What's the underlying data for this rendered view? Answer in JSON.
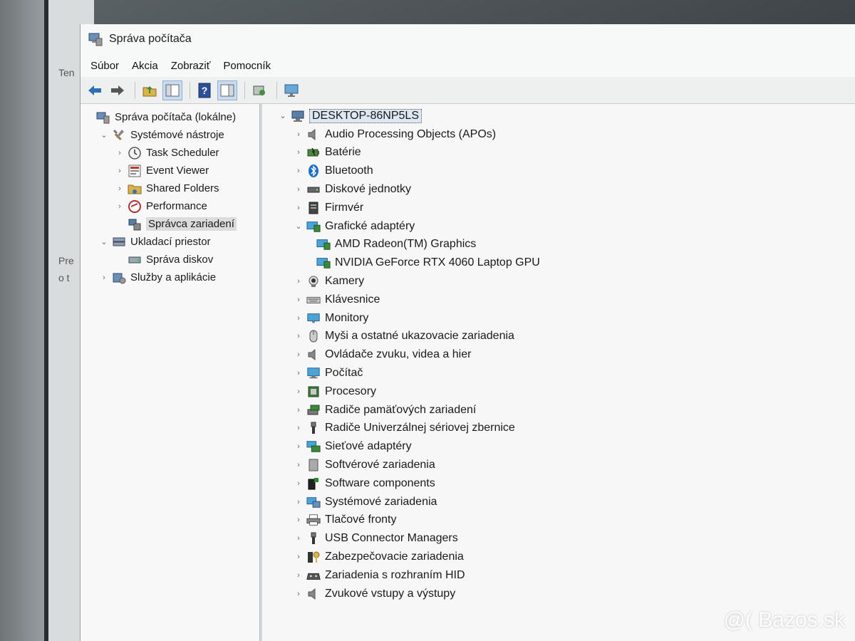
{
  "desktop": {
    "text_1": "Ten",
    "text_2": "Pre",
    "text_3": "o t"
  },
  "window": {
    "title": "Správa počítača"
  },
  "menu": [
    "Súbor",
    "Akcia",
    "Zobraziť",
    "Pomocník"
  ],
  "toolbar": [
    "back-icon",
    "forward-icon",
    "up-folder-icon",
    "console-tree-icon",
    "help-icon",
    "action-pane-icon",
    "properties-icon",
    "monitor-icon"
  ],
  "left_tree": [
    {
      "label": "Správa počítača (lokálne)",
      "indent": 0,
      "chev": "",
      "icon": "computer-management-icon"
    },
    {
      "label": "Systémové nástroje",
      "indent": 1,
      "chev": "v",
      "icon": "tools-icon"
    },
    {
      "label": "Task Scheduler",
      "indent": 2,
      "chev": ">",
      "icon": "clock-icon"
    },
    {
      "label": "Event Viewer",
      "indent": 2,
      "chev": ">",
      "icon": "event-viewer-icon"
    },
    {
      "label": "Shared Folders",
      "indent": 2,
      "chev": ">",
      "icon": "shared-folder-icon"
    },
    {
      "label": "Performance",
      "indent": 2,
      "chev": ">",
      "icon": "performance-icon"
    },
    {
      "label": "Správca zariadení",
      "indent": 2,
      "chev": "",
      "icon": "device-manager-icon",
      "selected": true
    },
    {
      "label": "Ukladací priestor",
      "indent": 1,
      "chev": "v",
      "icon": "storage-icon"
    },
    {
      "label": "Správa diskov",
      "indent": 2,
      "chev": "",
      "icon": "disk-management-icon"
    },
    {
      "label": "Služby a aplikácie",
      "indent": 1,
      "chev": ">",
      "icon": "services-icon"
    }
  ],
  "device_tree": {
    "root": "DESKTOP-86NP5LS",
    "items": [
      {
        "label": "Audio Processing Objects (APOs)",
        "icon": "speaker-icon",
        "expanded": false
      },
      {
        "label": "Batérie",
        "icon": "battery-icon",
        "expanded": false
      },
      {
        "label": "Bluetooth",
        "icon": "bluetooth-icon",
        "expanded": false
      },
      {
        "label": "Diskové jednotky",
        "icon": "disk-drive-icon",
        "expanded": false
      },
      {
        "label": "Firmvér",
        "icon": "firmware-icon",
        "expanded": false
      },
      {
        "label": "Grafické adaptéry",
        "icon": "display-adapter-icon",
        "expanded": true,
        "children": [
          {
            "label": "AMD Radeon(TM) Graphics",
            "icon": "display-adapter-icon"
          },
          {
            "label": "NVIDIA GeForce RTX 4060 Laptop GPU",
            "icon": "display-adapter-icon"
          }
        ]
      },
      {
        "label": "Kamery",
        "icon": "camera-icon",
        "expanded": false
      },
      {
        "label": "Klávesnice",
        "icon": "keyboard-icon",
        "expanded": false
      },
      {
        "label": "Monitory",
        "icon": "monitor-icon",
        "expanded": false
      },
      {
        "label": "Myši a ostatné ukazovacie zariadenia",
        "icon": "mouse-icon",
        "expanded": false
      },
      {
        "label": "Ovládače zvuku, videa a hier",
        "icon": "speaker-icon",
        "expanded": false
      },
      {
        "label": "Počítač",
        "icon": "computer-icon",
        "expanded": false
      },
      {
        "label": "Procesory",
        "icon": "processor-icon",
        "expanded": false
      },
      {
        "label": "Radiče pamäťových zariadení",
        "icon": "storage-controller-icon",
        "expanded": false
      },
      {
        "label": "Radiče Univerzálnej sériovej zbernice",
        "icon": "usb-icon",
        "expanded": false
      },
      {
        "label": "Sieťové adaptéry",
        "icon": "network-adapter-icon",
        "expanded": false
      },
      {
        "label": "Softvérové zariadenia",
        "icon": "software-device-icon",
        "expanded": false
      },
      {
        "label": "Software components",
        "icon": "software-component-icon",
        "expanded": false
      },
      {
        "label": "Systémové zariadenia",
        "icon": "system-device-icon",
        "expanded": false
      },
      {
        "label": "Tlačové fronty",
        "icon": "printer-icon",
        "expanded": false
      },
      {
        "label": "USB Connector Managers",
        "icon": "usb-icon",
        "expanded": false
      },
      {
        "label": "Zabezpečovacie zariadenia",
        "icon": "security-device-icon",
        "expanded": false
      },
      {
        "label": "Zariadenia s rozhraním HID",
        "icon": "hid-icon",
        "expanded": false
      },
      {
        "label": "Zvukové vstupy a výstupy",
        "icon": "speaker-icon",
        "expanded": false
      }
    ]
  },
  "watermark": "@( Bazos.sk"
}
